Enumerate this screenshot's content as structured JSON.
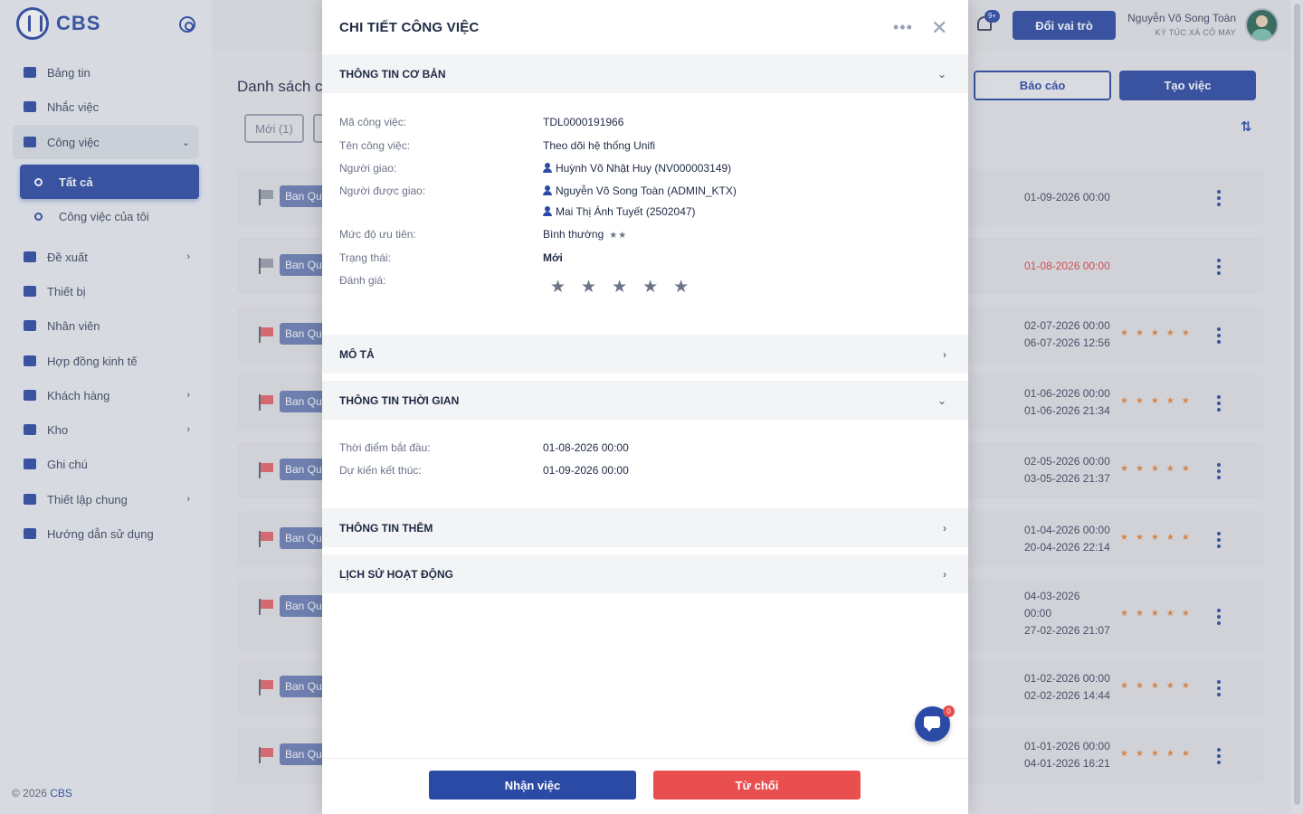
{
  "app": {
    "logo_text": "CBS"
  },
  "sidebar": {
    "items": [
      {
        "label": "Bảng tin",
        "icon": "newspaper-icon"
      },
      {
        "label": "Nhắc việc",
        "icon": "megaphone-icon"
      },
      {
        "label": "Công việc",
        "icon": "briefcase-icon",
        "expanded": true
      },
      {
        "label": "Đề xuất",
        "icon": "document-icon"
      },
      {
        "label": "Thiết bị",
        "icon": "device-icon"
      },
      {
        "label": "Nhân viên",
        "icon": "users-icon"
      },
      {
        "label": "Hợp đồng kinh tế",
        "icon": "contract-icon"
      },
      {
        "label": "Khách hàng",
        "icon": "customer-icon"
      },
      {
        "label": "Kho",
        "icon": "warehouse-icon"
      },
      {
        "label": "Ghi chú",
        "icon": "note-icon"
      },
      {
        "label": "Thiết lập chung",
        "icon": "gear-icon"
      },
      {
        "label": "Hướng dẫn sử dụng",
        "icon": "guide-icon"
      }
    ],
    "sub_items": [
      {
        "label": "Tất cả",
        "active": true
      },
      {
        "label": "Công việc của tôi",
        "active": false
      }
    ],
    "footer_year": "© 2026 ",
    "footer_brand": "CBS"
  },
  "header": {
    "notification_badge": "9+",
    "role_button": "Đổi vai trò",
    "user_name": "Nguyễn Võ Song Toàn",
    "user_org": "KÝ TÚC XÁ CỎ MAY"
  },
  "list": {
    "title": "Danh sách c",
    "filter_label": "Mới (1)",
    "report_button": "Báo cáo",
    "create_button": "Tạo việc",
    "tasks": [
      {
        "tag": "Ban Quả",
        "date1": "01-09-2026 00:00",
        "date2": "",
        "overdue": false,
        "rated": false,
        "flag_color": "#9aa0ad"
      },
      {
        "tag": "Ban Quả",
        "date1": "01-08-2026 00:00",
        "date2": "",
        "overdue": true,
        "rated": false,
        "flag_color": "#9aa0ad"
      },
      {
        "tag": "Ban Quả",
        "date1": "02-07-2026 00:00",
        "date2": "06-07-2026 12:56",
        "overdue": false,
        "rated": true,
        "flag_color": "#e8646b"
      },
      {
        "tag": "Ban Quả",
        "date1": "01-06-2026 00:00",
        "date2": "01-06-2026 21:34",
        "overdue": false,
        "rated": true,
        "flag_color": "#e8646b"
      },
      {
        "tag": "Ban Quả",
        "date1": "02-05-2026 00:00",
        "date2": "03-05-2026 21:37",
        "overdue": false,
        "rated": true,
        "flag_color": "#e8646b"
      },
      {
        "tag": "Ban Quả",
        "date1": "01-04-2026 00:00",
        "date2": "20-04-2026 22:14",
        "overdue": false,
        "rated": true,
        "flag_color": "#e8646b"
      },
      {
        "tag": "Ban Quả",
        "date1": "04-03-2026",
        "date1b": "00:00",
        "date2": "27-02-2026 21:07",
        "overdue": false,
        "rated": true,
        "flag_color": "#e8646b"
      },
      {
        "tag": "Ban Quả",
        "date1": "01-02-2026 00:00",
        "date2": "02-02-2026 14:44",
        "overdue": false,
        "rated": true,
        "flag_color": "#e8646b"
      },
      {
        "tag": "Ban Quả",
        "date1": "01-01-2026 00:00",
        "date2": "04-01-2026 16:21",
        "overdue": false,
        "rated": true,
        "flag_color": "#e8646b"
      }
    ],
    "stars": "★★★★★"
  },
  "drawer": {
    "title": "CHI TIẾT CÔNG VIỆC",
    "more": "•••",
    "close": "✕",
    "sections": {
      "basic": "THÔNG TIN CƠ BẢN",
      "description": "MÔ TẢ",
      "time": "THÔNG TIN THỜI GIAN",
      "extra": "THÔNG TIN THÊM",
      "history": "LỊCH SỬ HOẠT ĐỘNG"
    },
    "basic": {
      "code_label": "Mã công việc:",
      "code": "TDL0000191966",
      "name_label": "Tên công việc:",
      "name": "Theo dõi hệ thống Unifi",
      "assigner_label": "Người giao:",
      "assigner": "Huỳnh Võ Nhật Huy (NV000003149)",
      "assignees_label": "Người được giao:",
      "assignee_1": "Nguyễn Võ Song Toàn (ADMIN_KTX)",
      "assignee_2": "Mai Thị Ánh Tuyết (2502047)",
      "priority_label": "Mức độ ưu tiên:",
      "priority": "Bình thường",
      "priority_stars": "★★",
      "status_label": "Trạng thái:",
      "status": "Mới",
      "rating_label": "Đánh giá:",
      "rating_stars": "★★★★★",
      "rating_value": 0
    },
    "time": {
      "start_label": "Thời điểm bắt đầu:",
      "start": "01-08-2026 00:00",
      "end_label": "Dự kiến kết thúc:",
      "end": "01-09-2026 00:00"
    },
    "chat_badge": "0",
    "accept_button": "Nhận việc",
    "reject_button": "Từ chối"
  },
  "colors": {
    "primary": "#2b4aa6",
    "danger": "#e94f4f",
    "overdue_text": "#e04545",
    "star": "#e8873b"
  }
}
